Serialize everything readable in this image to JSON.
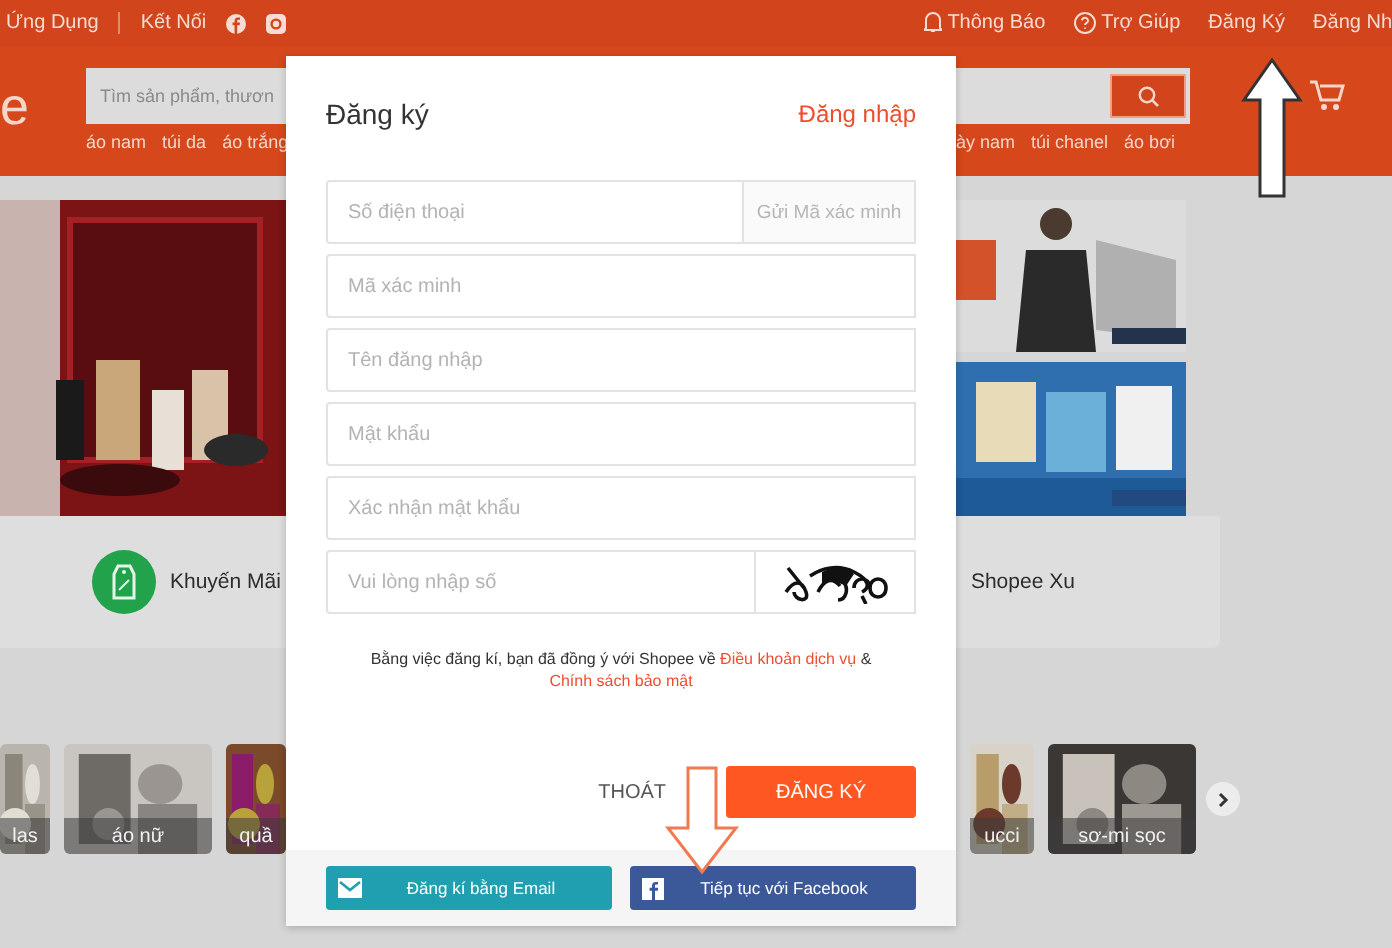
{
  "top_bar": {
    "left": [
      {
        "label": "Ứng Dụng",
        "kind": "text"
      },
      {
        "label": "Kết Nối",
        "kind": "social"
      }
    ],
    "right": [
      {
        "label": "Thông Báo",
        "kind": "bell"
      },
      {
        "label": "Trợ Giúp",
        "kind": "help"
      },
      {
        "label": "Đăng Ký",
        "kind": "text"
      },
      {
        "label": "Đăng Nh",
        "kind": "text"
      }
    ]
  },
  "header": {
    "logo": "e",
    "search": {
      "placeholder": "Tìm sản phẩm, thươn"
    },
    "tags_left": [
      "áo nam",
      "túi da",
      "áo trắng"
    ],
    "tags_right": [
      "ày nam",
      "túi chanel",
      "áo bơi"
    ]
  },
  "categories": [
    {
      "label": "Khuyến Mãi",
      "kind": "promo"
    },
    {
      "label": "Shopee Xu",
      "kind": "plain"
    }
  ],
  "thumbnails_left": [
    {
      "label": "las"
    },
    {
      "label": "áo nữ"
    },
    {
      "label": "quầ"
    }
  ],
  "thumbnails_right": [
    {
      "label": "ucci"
    },
    {
      "label": "sơ-mi sọc"
    }
  ],
  "modal": {
    "title": "Đăng ký",
    "login_link": "Đăng nhập",
    "fields": [
      {
        "placeholder": "Số điện thoại",
        "kind": "send",
        "action": "Gửi Mã xác minh"
      },
      {
        "placeholder": "Mã xác minh",
        "kind": "plain"
      },
      {
        "placeholder": "Tên đăng nhập",
        "kind": "plain"
      },
      {
        "placeholder": "Mật khẩu",
        "kind": "plain"
      },
      {
        "placeholder": "Xác nhận mật khẩu",
        "kind": "plain"
      },
      {
        "placeholder": "Vui lòng nhập số",
        "kind": "captcha"
      }
    ],
    "terms": {
      "text": "Bằng việc đăng kí, bạn đã đồng ý với Shopee về",
      "links": [
        "Điều khoản dịch vụ",
        "Chính sách bảo mật"
      ],
      "joiner": "&"
    },
    "cancel": "THOÁT",
    "submit": "ĐĂNG KÝ",
    "social": [
      {
        "label": "Đăng kí bằng Email",
        "kind": "email"
      },
      {
        "label": "Tiếp tục với Facebook",
        "kind": "facebook"
      }
    ]
  }
}
